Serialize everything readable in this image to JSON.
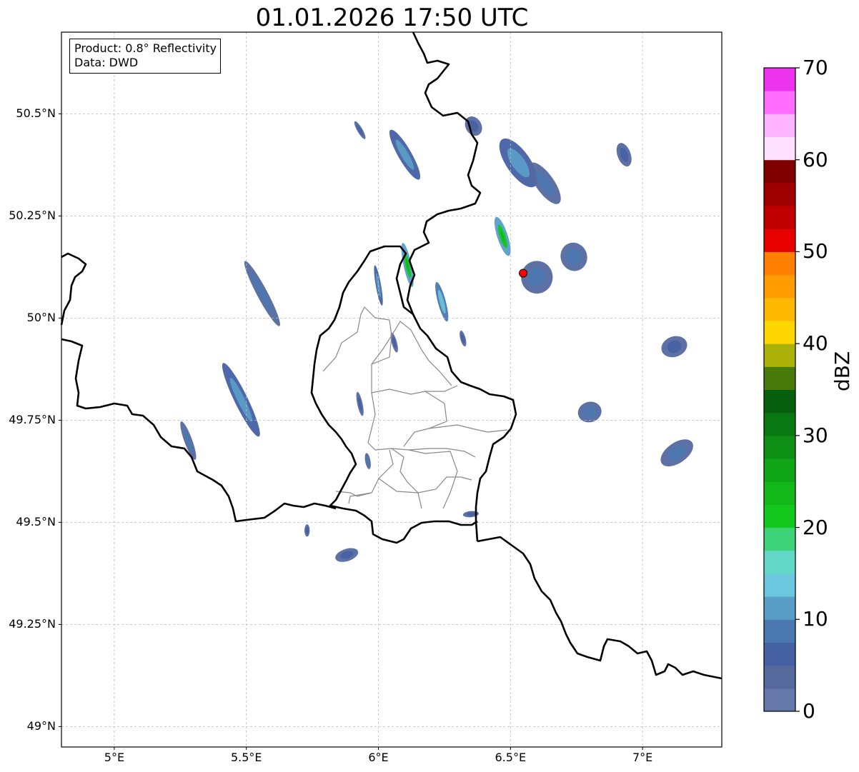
{
  "title": "01.01.2026 17:50 UTC",
  "info": {
    "product": "Product: 0.8° Reflectivity",
    "source": "Data: DWD"
  },
  "axes": {
    "lon_range": [
      4.8,
      7.3
    ],
    "lat_range": [
      48.95,
      50.7
    ],
    "lat_ticks": [
      {
        "value": 50.5,
        "label": "50.5°N"
      },
      {
        "value": 50.25,
        "label": "50.25°N"
      },
      {
        "value": 50.0,
        "label": "50°N"
      },
      {
        "value": 49.75,
        "label": "49.75°N"
      },
      {
        "value": 49.5,
        "label": "49.5°N"
      },
      {
        "value": 49.25,
        "label": "49.25°N"
      },
      {
        "value": 49.0,
        "label": "49°N"
      }
    ],
    "lon_ticks": [
      {
        "value": 5.0,
        "label": "5°E"
      },
      {
        "value": 5.5,
        "label": "5.5°E"
      },
      {
        "value": 6.0,
        "label": "6°E"
      },
      {
        "value": 6.5,
        "label": "6.5°E"
      },
      {
        "value": 7.0,
        "label": "7°E"
      }
    ]
  },
  "radar_site": {
    "lon": 6.548,
    "lat": 50.11,
    "color": "#ff0000"
  },
  "colorbar": {
    "label": "dBZ",
    "min": 0,
    "max": 70,
    "step": 2.5,
    "ticks": [
      "0",
      "10",
      "20",
      "30",
      "40",
      "50",
      "60",
      "70"
    ],
    "colors": [
      "#6677aa",
      "#55699f",
      "#4660a4",
      "#4b78b0",
      "#5a9ec8",
      "#6cc6dd",
      "#64d8c8",
      "#3ed378",
      "#14c81e",
      "#12b81a",
      "#10a417",
      "#0d8e15",
      "#0a7812",
      "#075e0c",
      "#477a0b",
      "#adb20a",
      "#ffd700",
      "#ffb800",
      "#ff9c00",
      "#ff7f00",
      "#e60000",
      "#c00000",
      "#a00000",
      "#800000",
      "#ffe0ff",
      "#ffb4ff",
      "#ff6eff",
      "#ee33ee"
    ]
  },
  "echo_cells": [
    {
      "lon": 6.53,
      "lat": 50.38,
      "w": 0.09,
      "h": 0.14,
      "angle": -35,
      "dbz": 12
    },
    {
      "lon": 6.63,
      "lat": 50.33,
      "w": 0.07,
      "h": 0.12,
      "angle": -35,
      "dbz": 8
    },
    {
      "lon": 6.36,
      "lat": 50.47,
      "w": 0.06,
      "h": 0.05,
      "angle": -30,
      "dbz": 6
    },
    {
      "lon": 6.1,
      "lat": 50.4,
      "w": 0.05,
      "h": 0.14,
      "angle": -30,
      "dbz": 10
    },
    {
      "lon": 5.93,
      "lat": 50.46,
      "w": 0.02,
      "h": 0.05,
      "angle": -30,
      "dbz": 6
    },
    {
      "lon": 5.56,
      "lat": 50.06,
      "w": 0.04,
      "h": 0.18,
      "angle": -28,
      "dbz": 8
    },
    {
      "lon": 5.48,
      "lat": 49.8,
      "w": 0.05,
      "h": 0.2,
      "angle": -26,
      "dbz": 10
    },
    {
      "lon": 5.28,
      "lat": 49.7,
      "w": 0.03,
      "h": 0.1,
      "angle": -20,
      "dbz": 8
    },
    {
      "lon": 6.11,
      "lat": 50.13,
      "w": 0.03,
      "h": 0.11,
      "angle": -12,
      "dbz": 20
    },
    {
      "lon": 6.0,
      "lat": 50.08,
      "w": 0.02,
      "h": 0.1,
      "angle": -10,
      "dbz": 10
    },
    {
      "lon": 6.24,
      "lat": 50.04,
      "w": 0.03,
      "h": 0.1,
      "angle": -15,
      "dbz": 14
    },
    {
      "lon": 6.47,
      "lat": 50.2,
      "w": 0.04,
      "h": 0.1,
      "angle": -18,
      "dbz": 20
    },
    {
      "lon": 6.6,
      "lat": 50.1,
      "w": 0.12,
      "h": 0.08,
      "angle": 0,
      "dbz": 9
    },
    {
      "lon": 6.74,
      "lat": 50.15,
      "w": 0.1,
      "h": 0.07,
      "angle": -20,
      "dbz": 8
    },
    {
      "lon": 6.93,
      "lat": 50.4,
      "w": 0.05,
      "h": 0.06,
      "angle": -20,
      "dbz": 6
    },
    {
      "lon": 6.8,
      "lat": 49.77,
      "w": 0.09,
      "h": 0.05,
      "angle": -15,
      "dbz": 8
    },
    {
      "lon": 7.12,
      "lat": 49.93,
      "w": 0.1,
      "h": 0.05,
      "angle": -20,
      "dbz": 7
    },
    {
      "lon": 7.13,
      "lat": 49.67,
      "w": 0.14,
      "h": 0.05,
      "angle": -35,
      "dbz": 8
    },
    {
      "lon": 5.73,
      "lat": 49.48,
      "w": 0.02,
      "h": 0.03,
      "angle": 0,
      "dbz": 6
    },
    {
      "lon": 5.88,
      "lat": 49.42,
      "w": 0.09,
      "h": 0.03,
      "angle": -18,
      "dbz": 7
    },
    {
      "lon": 5.93,
      "lat": 49.79,
      "w": 0.02,
      "h": 0.06,
      "angle": -12,
      "dbz": 6
    },
    {
      "lon": 5.96,
      "lat": 49.65,
      "w": 0.02,
      "h": 0.04,
      "angle": -10,
      "dbz": 8
    },
    {
      "lon": 6.35,
      "lat": 49.52,
      "w": 0.06,
      "h": 0.015,
      "angle": -5,
      "dbz": 6
    },
    {
      "lon": 6.06,
      "lat": 49.94,
      "w": 0.02,
      "h": 0.05,
      "angle": -15,
      "dbz": 6
    },
    {
      "lon": 6.32,
      "lat": 49.95,
      "w": 0.02,
      "h": 0.04,
      "angle": -15,
      "dbz": 6
    }
  ]
}
